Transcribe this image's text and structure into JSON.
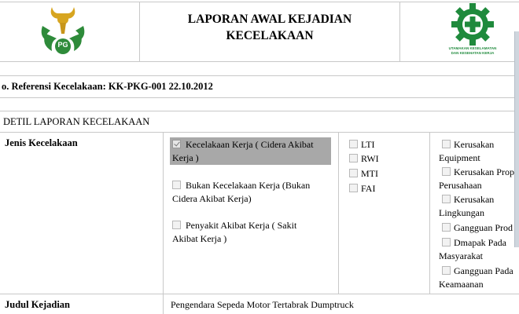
{
  "header": {
    "title_line1": "LAPORAN AWAL KEJADIAN",
    "title_line2": "KECELAKAAN",
    "left_logo": {
      "name": "pg-logo",
      "text": "PG",
      "color": "#2e8b3a"
    },
    "right_logo": {
      "name": "k3-logo",
      "line1": "UTAMAKAN KESELAMATAN",
      "line2": "DAN KESEHATAN KERJA",
      "color": "#1f8a3c"
    }
  },
  "reference": {
    "text": "o. Referensi Kecelakaan: KK-PKG-001 22.10.2012"
  },
  "section_title": "DETIL LAPORAN KECELAKAAN",
  "jenis": {
    "label": "Jenis Kecelakaan",
    "options": [
      {
        "line1": "Kecelakaan Kerja ( Cidera Akibat",
        "line2": "Kerja )",
        "checked": true
      },
      {
        "line1": "Bukan Kecelakaan Kerja (Bukan",
        "line2": "Cidera Akibat Kerja)",
        "checked": false
      },
      {
        "line1": "Penyakit Akibat Kerja ( Sakit",
        "line2": "Akibat Kerja )",
        "checked": false
      }
    ],
    "categories": [
      "LTI",
      "RWI",
      "MTI",
      "FAI"
    ],
    "damages": [
      {
        "line1": "Kerusakan",
        "line2": "Equipment"
      },
      {
        "line1": "Kerusakan Prop",
        "line2": "Perusahaan"
      },
      {
        "line1": "Kerusakan",
        "line2": "Lingkungan"
      },
      {
        "line1": "Gangguan Prod",
        "line2": ""
      },
      {
        "line1": "Dmapak Pada",
        "line2": "Masyarakat"
      },
      {
        "line1": "Gangguan Pada",
        "line2": "Keamaanan"
      }
    ]
  },
  "judul": {
    "label": "Judul Kejadian",
    "value": "Pengendara Sepeda Motor Tertabrak Dumptruck"
  },
  "colors": {
    "grid": "#c8c8c8",
    "checked_highlight": "#a8a8a8"
  }
}
